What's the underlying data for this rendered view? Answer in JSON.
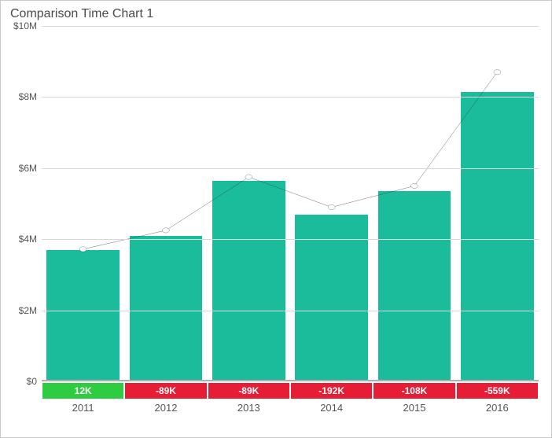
{
  "title": "Comparison Time Chart 1",
  "y_ticks": [
    "$0",
    "$2M",
    "$4M",
    "$6M",
    "$8M",
    "$10M"
  ],
  "categories": [
    "2011",
    "2012",
    "2013",
    "2014",
    "2015",
    "2016"
  ],
  "badges": [
    {
      "label": "12K",
      "positive": true
    },
    {
      "label": "-89K",
      "positive": false
    },
    {
      "label": "-89K",
      "positive": false
    },
    {
      "label": "-192K",
      "positive": false
    },
    {
      "label": "-108K",
      "positive": false
    },
    {
      "label": "-559K",
      "positive": false
    }
  ],
  "colors": {
    "bar": "#1abc9c",
    "line": "#333333",
    "badge_pos": "#2ecc40",
    "badge_neg": "#e71d36"
  },
  "chart_data": {
    "type": "bar",
    "title": "Comparison Time Chart 1",
    "xlabel": "",
    "ylabel": "",
    "ylim": [
      0,
      10000000
    ],
    "y_tick_values": [
      0,
      2000000,
      4000000,
      6000000,
      8000000,
      10000000
    ],
    "categories": [
      "2011",
      "2012",
      "2013",
      "2014",
      "2015",
      "2016"
    ],
    "series": [
      {
        "name": "Bars",
        "type": "bar",
        "values": [
          3700000,
          4100000,
          5650000,
          4700000,
          5350000,
          8150000
        ]
      },
      {
        "name": "Line",
        "type": "line",
        "values": [
          3720000,
          4250000,
          5750000,
          4900000,
          5500000,
          8700000
        ]
      }
    ],
    "difference_badges": [
      {
        "category": "2011",
        "value": 12000,
        "label": "12K"
      },
      {
        "category": "2012",
        "value": -89000,
        "label": "-89K"
      },
      {
        "category": "2013",
        "value": -89000,
        "label": "-89K"
      },
      {
        "category": "2014",
        "value": -192000,
        "label": "-192K"
      },
      {
        "category": "2015",
        "value": -108000,
        "label": "-108K"
      },
      {
        "category": "2016",
        "value": -559000,
        "label": "-559K"
      }
    ]
  }
}
